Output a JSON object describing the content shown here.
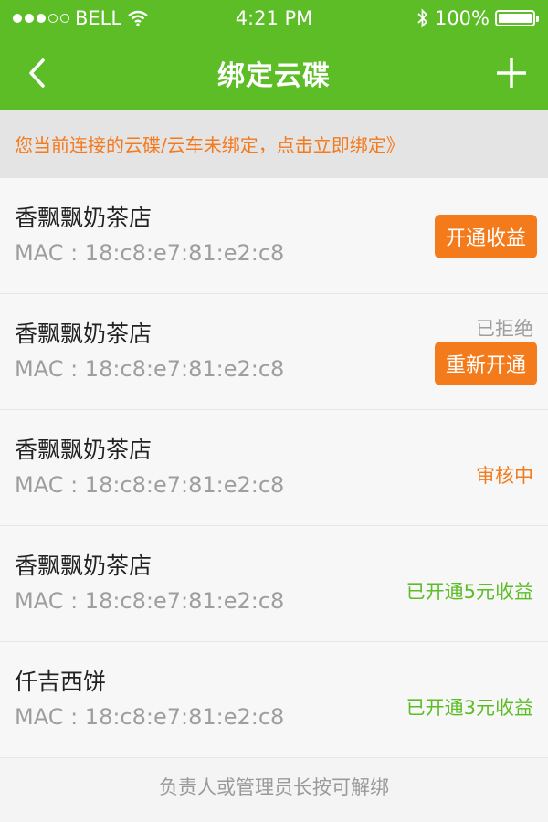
{
  "status_bar": {
    "carrier": "BELL",
    "time": "4:21 PM",
    "battery": "100%"
  },
  "nav": {
    "title": "绑定云碟",
    "back_icon": "chevron-left-icon",
    "add_icon": "plus-icon"
  },
  "notice": "您当前连接的云碟/云车未绑定，点击立即绑定》",
  "devices": [
    {
      "name": "香飘飘奶茶店",
      "mac": "MAC : 18:c8:e7:81:e2:c8",
      "status": "",
      "button": "开通收益"
    },
    {
      "name": "香飘飘奶茶店",
      "mac": "MAC : 18:c8:e7:81:e2:c8",
      "status": "已拒绝",
      "button": "重新开通"
    },
    {
      "name": "香飘飘奶茶店",
      "mac": "MAC : 18:c8:e7:81:e2:c8",
      "status": "审核中",
      "button": ""
    },
    {
      "name": "香飘飘奶茶店",
      "mac": "MAC : 18:c8:e7:81:e2:c8",
      "status": "已开通5元收益",
      "button": ""
    },
    {
      "name": "仟吉西饼",
      "mac": "MAC : 18:c8:e7:81:e2:c8",
      "status": "已开通3元收益",
      "button": ""
    }
  ],
  "footer_hint": "负责人或管理员长按可解绑",
  "colors": {
    "brand_green": "#5cbd27",
    "orange": "#f47b1c",
    "muted_gray": "#9e9e9e"
  }
}
